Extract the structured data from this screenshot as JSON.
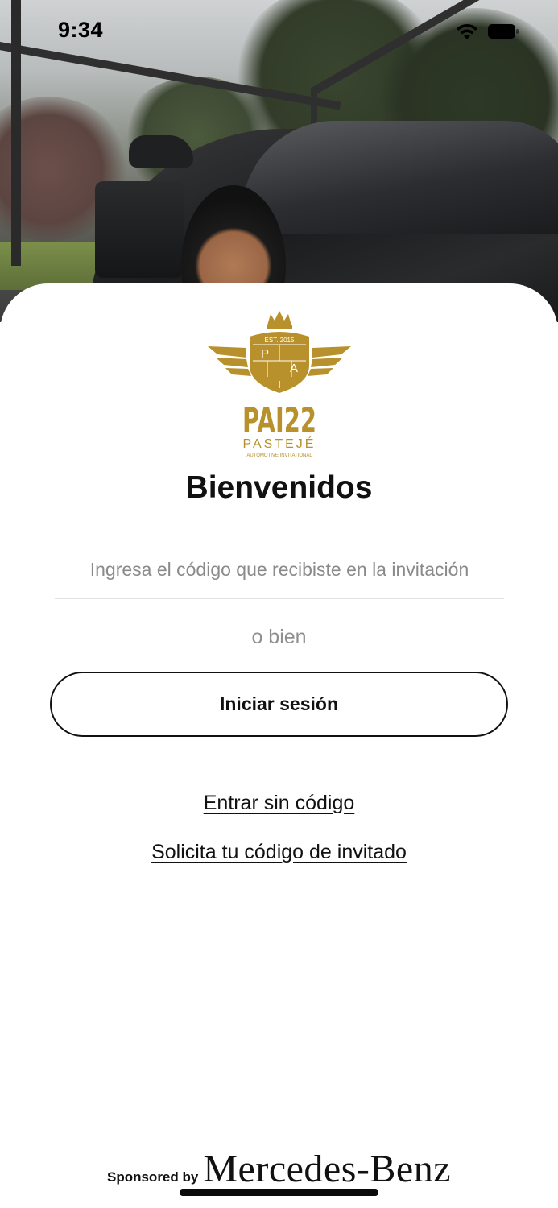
{
  "status_bar": {
    "time": "9:34"
  },
  "logo": {
    "wordmark": "PAI22",
    "subtitle": "PASTEJÉ",
    "tagline": "AUTOMOTIVE INVITATIONAL",
    "shield_letters": [
      "P",
      "A",
      "I"
    ],
    "shield_text": "EST. 2015",
    "color": "#b8902c"
  },
  "welcome": {
    "title": "Bienvenidos"
  },
  "code_field": {
    "placeholder": "Ingresa el código que recibiste en la invitación",
    "value": ""
  },
  "divider": {
    "label": "o bien"
  },
  "login_button": {
    "label": "Iniciar sesión"
  },
  "links": {
    "enter_without_code": "Entrar sin código",
    "request_code": "Solicita tu código de invitado"
  },
  "sponsor": {
    "label": "Sponsored by",
    "brand": "Mercedes-Benz"
  },
  "colors": {
    "gold": "#b8902c",
    "text": "#111111",
    "muted": "#8a8a8a"
  }
}
